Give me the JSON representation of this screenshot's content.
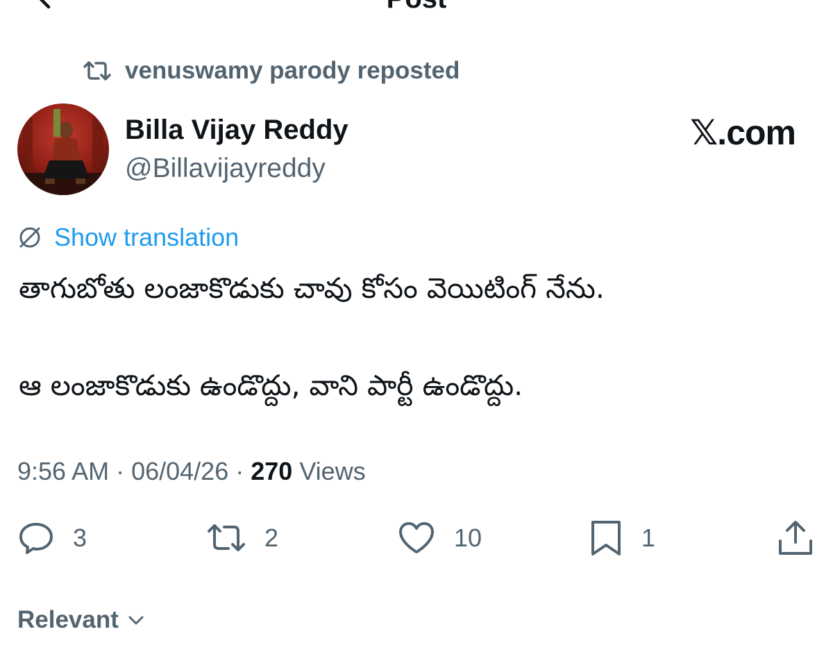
{
  "header": {
    "title": "Post",
    "back_icon": "chevron-left-icon",
    "more_icon": "more-horizontal-icon"
  },
  "repost": {
    "text": "venuswamy parody reposted",
    "icon": "repost-icon"
  },
  "author": {
    "name": "Billa Vijay Reddy",
    "handle": "@Billavijayreddy"
  },
  "watermark": "𝕏.com",
  "translation": {
    "label": "Show translation",
    "icon": "translate-icon"
  },
  "tweet": {
    "line1": "తాగుబోతు లంజాకొడుకు చావు కోసం వెయిటింగ్ నేను.",
    "line2": "ఆ లంజాకొడుకు ఉండొద్దు, వాని పార్టీ ఉండొద్దు."
  },
  "meta": {
    "time": "9:56 AM",
    "separator": " · ",
    "date": "06/04/26",
    "views_count": "270",
    "views_label": " Views"
  },
  "actions": {
    "replies": "3",
    "reposts": "2",
    "likes": "10",
    "bookmarks": "1"
  },
  "sort": {
    "label": "Relevant"
  },
  "colors": {
    "text_primary": "#0f1419",
    "text_secondary": "#536471",
    "link": "#1d9bf0",
    "background": "#ffffff"
  }
}
